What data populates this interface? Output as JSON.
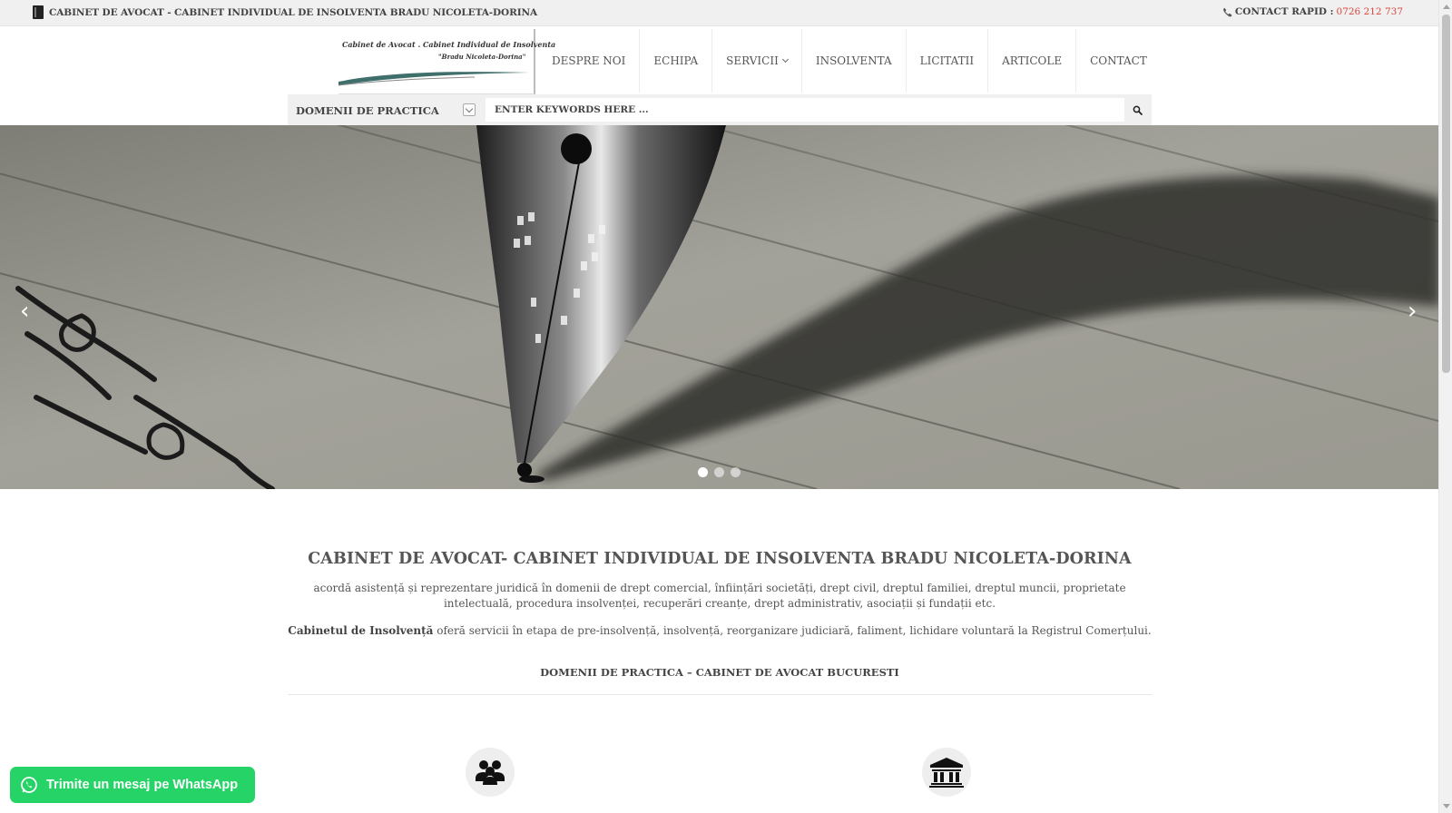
{
  "topbar": {
    "brand": "CABINET DE AVOCAT - CABINET INDIVIDUAL DE INSOLVENTA BRADU NICOLETA-DORINA",
    "contact_label": "CONTACT RAPID :",
    "contact_phone": "0726 212 737"
  },
  "logo": {
    "line1": "Cabinet de Avocat . Cabinet Individual de Insolventa",
    "line2": "\"Bradu Nicoleta-Dorina\""
  },
  "nav": {
    "items": [
      {
        "label": "DESPRE NOI"
      },
      {
        "label": "ECHIPA"
      },
      {
        "label": "SERVICII"
      },
      {
        "label": "INSOLVENTA"
      },
      {
        "label": "LICITATII"
      },
      {
        "label": "ARTICOLE"
      },
      {
        "label": "CONTACT"
      }
    ]
  },
  "search": {
    "practice_label": "DOMENII DE PRACTICA",
    "placeholder": "ENTER KEYWORDS HERE ..."
  },
  "slider": {
    "prev": "‹",
    "next": "›",
    "slide_count": 3,
    "active_slide": 1
  },
  "intro": {
    "title": "CABINET DE AVOCAT- CABINET INDIVIDUAL DE INSOLVENTA BRADU NICOLETA-DORINA",
    "p1": "acordă asistență și reprezentare juridică în domenii de drept comercial, înființări societăți, drept civil, dreptul familiei, dreptul muncii, proprietate intelectuală, procedura insolvenței, recuperări creanțe, drept administrativ, asociații și fundații etc.",
    "p2_bold": "Cabinetul de Insolvență",
    "p2_rest": " oferă servicii în etapa de pre-insolvență, insolvență, reorganizare judiciară, faliment, lichidare voluntară la Registrul Comerțului.",
    "subtitle": "DOMENII DE PRACTICA – CABINET DE AVOCAT BUCURESTI"
  },
  "features": [
    {
      "icon": "people-group-icon"
    },
    {
      "icon": "courthouse-icon"
    }
  ],
  "whatsapp": {
    "label": "Trimite un mesaj pe WhatsApp"
  }
}
